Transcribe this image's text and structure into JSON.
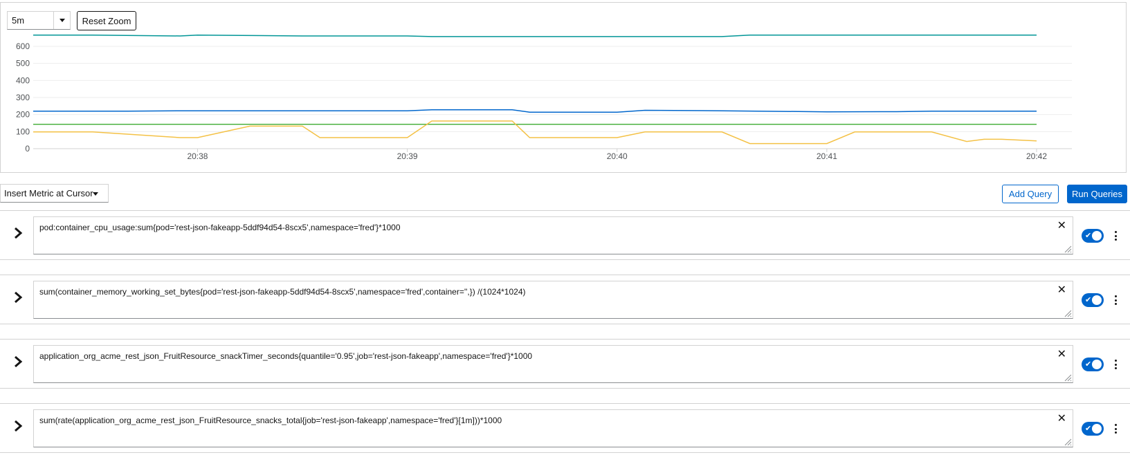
{
  "graph": {
    "span": "5m",
    "reset_zoom_label": "Reset Zoom"
  },
  "chart_data": {
    "type": "line",
    "ylim": [
      0,
      700
    ],
    "y_ticks": [
      0,
      100,
      200,
      300,
      400,
      500,
      600
    ],
    "x_range": [
      "20:37:13",
      "20:42"
    ],
    "x_ticks": [
      "20:38",
      "20:39",
      "20:40",
      "20:41",
      "20:42"
    ],
    "grid": true,
    "colors": {
      "teal": "#009596",
      "blue": "#06c",
      "green": "#4cb140",
      "yellow": "#f4c145"
    },
    "series": [
      {
        "color_key": "teal",
        "points": [
          [
            "20:37:13",
            666
          ],
          [
            "20:37:30",
            666
          ],
          [
            "20:38",
            666
          ],
          [
            "20:37:55",
            661
          ],
          [
            "20:38:30",
            661
          ],
          [
            "20:39",
            661
          ],
          [
            "20:39:07",
            657
          ],
          [
            "20:40",
            657
          ],
          [
            "20:40:30",
            657
          ],
          [
            "20:40:38",
            666
          ],
          [
            "20:41",
            666
          ],
          [
            "20:42",
            666
          ]
        ]
      },
      {
        "color_key": "blue",
        "points": [
          [
            "20:37:13",
            220
          ],
          [
            "20:37:40",
            220
          ],
          [
            "20:37:55",
            222
          ],
          [
            "20:38:30",
            222
          ],
          [
            "20:39",
            222
          ],
          [
            "20:39:07",
            228
          ],
          [
            "20:39:30",
            228
          ],
          [
            "20:39:35",
            214
          ],
          [
            "20:40",
            214
          ],
          [
            "20:40:08",
            225
          ],
          [
            "20:40:30",
            222
          ],
          [
            "20:41",
            216
          ],
          [
            "20:41:20",
            217
          ],
          [
            "20:41:30",
            220
          ],
          [
            "20:42",
            220
          ]
        ]
      },
      {
        "color_key": "green",
        "points": [
          [
            "20:37:13",
            143
          ],
          [
            "20:42",
            143
          ]
        ]
      },
      {
        "color_key": "yellow",
        "points": [
          [
            "20:37:13",
            98
          ],
          [
            "20:37:30",
            98
          ],
          [
            "20:37:55",
            65
          ],
          [
            "20:38",
            65
          ],
          [
            "20:38:15",
            132
          ],
          [
            "20:38:30",
            132
          ],
          [
            "20:38:35",
            65
          ],
          [
            "20:39",
            65
          ],
          [
            "20:39:07",
            162
          ],
          [
            "20:39:30",
            162
          ],
          [
            "20:39:35",
            65
          ],
          [
            "20:40",
            65
          ],
          [
            "20:40:08",
            98
          ],
          [
            "20:40:30",
            98
          ],
          [
            "20:40:38",
            30
          ],
          [
            "20:41",
            30
          ],
          [
            "20:41:08",
            98
          ],
          [
            "20:41:30",
            98
          ],
          [
            "20:41:40",
            42
          ],
          [
            "20:41:45",
            55
          ],
          [
            "20:41:50",
            55
          ],
          [
            "20:42",
            46
          ]
        ]
      }
    ]
  },
  "toolbar": {
    "insert_metric_label": "Insert Metric at Cursor",
    "add_query_label": "Add Query",
    "run_queries_label": "Run Queries"
  },
  "queries": [
    {
      "text": "pod:container_cpu_usage:sum{pod='rest-json-fakeapp-5ddf94d54-8scx5',namespace='fred'}*1000",
      "enabled": true
    },
    {
      "text": "sum(container_memory_working_set_bytes{pod='rest-json-fakeapp-5ddf94d54-8scx5',namespace='fred',container='',}) /(1024*1024)",
      "enabled": true
    },
    {
      "text": "application_org_acme_rest_json_FruitResource_snackTimer_seconds{quantile='0.95',job='rest-json-fakeapp',namespace='fred'}*1000",
      "enabled": true
    },
    {
      "text": "sum(rate(application_org_acme_rest_json_FruitResource_snacks_total{job='rest-json-fakeapp',namespace='fred'}[1m]))*1000",
      "enabled": true
    }
  ]
}
